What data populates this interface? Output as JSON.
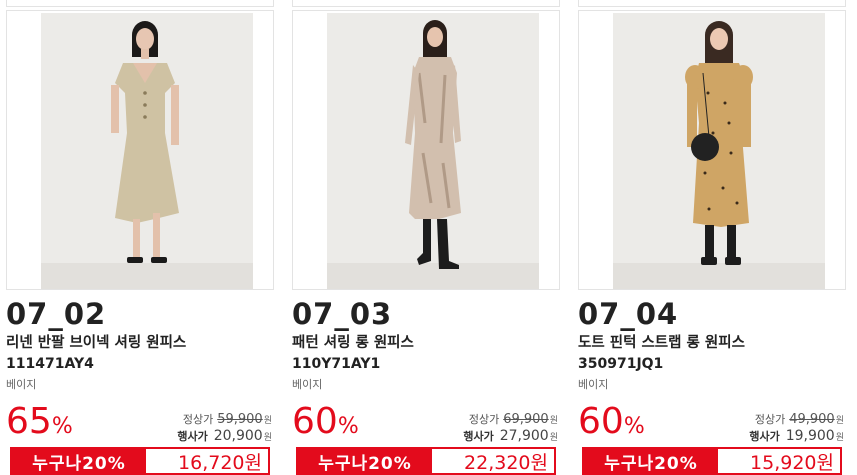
{
  "products": [
    {
      "code": "07_02",
      "name": "리넨 반팔 브이넥 셔링 원피스",
      "sku": "111471AY4",
      "color": "베이지",
      "discount_num": "65",
      "discount_sym": "%",
      "regular_label": "정상가",
      "regular_price": "59,900",
      "sale_label": "행사가",
      "sale_price": "20,900",
      "won": "원",
      "promo_label": "누구나20%",
      "promo_price": "16,720원",
      "illustration": "woman-beige-linen-dress"
    },
    {
      "code": "07_03",
      "name": "패턴 셔링 롱 원피스",
      "sku": "110Y71AY1",
      "color": "베이지",
      "discount_num": "60",
      "discount_sym": "%",
      "regular_label": "정상가",
      "regular_price": "69,900",
      "sale_label": "행사가",
      "sale_price": "27,900",
      "won": "원",
      "promo_label": "누구나20%",
      "promo_price": "22,320원",
      "illustration": "woman-patterned-long-dress"
    },
    {
      "code": "07_04",
      "name": "도트 핀턱 스트랩 롱 원피스",
      "sku": "350971JQ1",
      "color": "베이지",
      "discount_num": "60",
      "discount_sym": "%",
      "regular_label": "정상가",
      "regular_price": "49,900",
      "sale_label": "행사가",
      "sale_price": "19,900",
      "won": "원",
      "promo_label": "누구나20%",
      "promo_price": "15,920원",
      "illustration": "woman-dot-long-dress-with-bag"
    }
  ],
  "colors": {
    "accent": "#e30b1c",
    "border": "#e3e3e3"
  }
}
